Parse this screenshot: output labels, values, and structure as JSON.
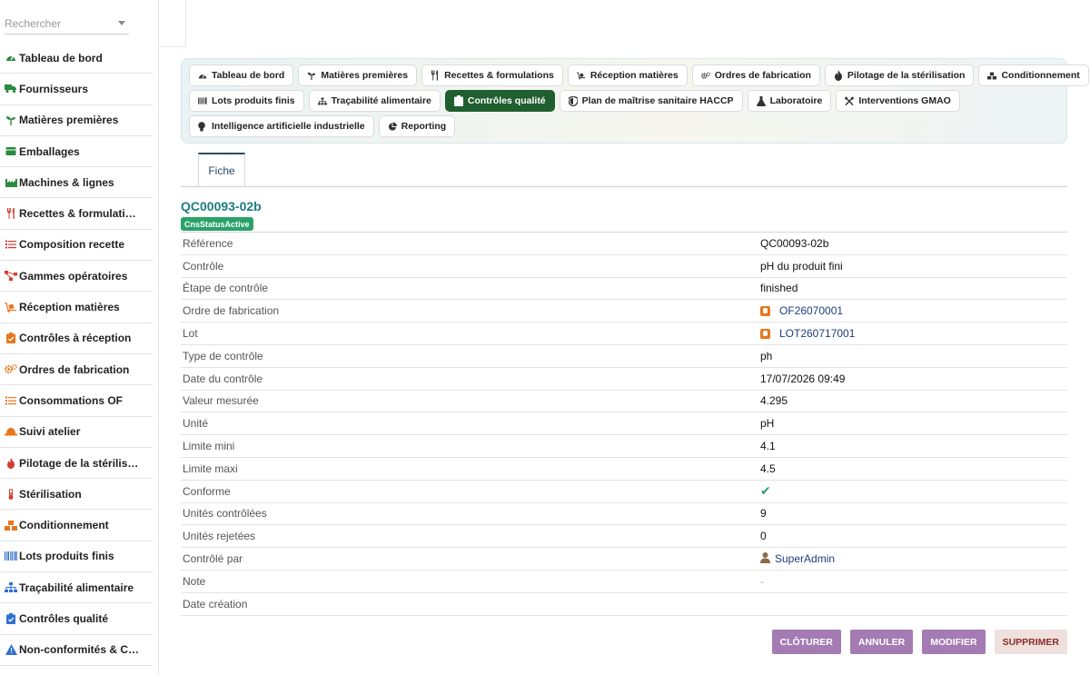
{
  "search": {
    "placeholder": "Rechercher"
  },
  "sidebar": {
    "items": [
      {
        "label": "Tableau de bord",
        "icon": "gauge-icon",
        "color": "#2a8a3e"
      },
      {
        "label": "Fournisseurs",
        "icon": "truck-icon",
        "color": "#2a8a3e"
      },
      {
        "label": "Matières premières",
        "icon": "seedling-icon",
        "color": "#2a8a3e"
      },
      {
        "label": "Emballages",
        "icon": "box-icon",
        "color": "#2a8a3e"
      },
      {
        "label": "Machines & lignes",
        "icon": "industry-icon",
        "color": "#2a8a3e"
      },
      {
        "label": "Recettes & formulati…",
        "icon": "utensils-icon",
        "color": "#d23c2f"
      },
      {
        "label": "Composition recette",
        "icon": "list-icon",
        "color": "#d23c2f"
      },
      {
        "label": "Gammes opératoires",
        "icon": "flow-icon",
        "color": "#d23c2f"
      },
      {
        "label": "Réception matières",
        "icon": "dolly-icon",
        "color": "#e8761d"
      },
      {
        "label": "Contrôles à réception",
        "icon": "clipboard-check-icon",
        "color": "#e8761d"
      },
      {
        "label": "Ordres de fabrication",
        "icon": "gears-icon",
        "color": "#e8761d"
      },
      {
        "label": "Consommations OF",
        "icon": "list-icon",
        "color": "#e8761d"
      },
      {
        "label": "Suivi atelier",
        "icon": "hardhat-icon",
        "color": "#e8761d"
      },
      {
        "label": "Pilotage de la stérilis…",
        "icon": "fire-icon",
        "color": "#d23c2f"
      },
      {
        "label": "Stérilisation",
        "icon": "thermometer-icon",
        "color": "#d23c2f"
      },
      {
        "label": "Conditionnement",
        "icon": "boxes-icon",
        "color": "#e8761d"
      },
      {
        "label": "Lots produits finis",
        "icon": "barcode-icon",
        "color": "#2f6fd1"
      },
      {
        "label": "Traçabilité alimentaire",
        "icon": "sitemap-icon",
        "color": "#2f6fd1"
      },
      {
        "label": "Contrôles qualité",
        "icon": "clipboard-check-icon",
        "color": "#2f6fd1"
      },
      {
        "label": "Non-conformités & C…",
        "icon": "warning-icon",
        "color": "#2f6fd1"
      }
    ]
  },
  "tabs": {
    "rows": [
      [
        {
          "label": "Tableau de bord",
          "icon": "gauge-icon"
        },
        {
          "label": "Matières premières",
          "icon": "seedling-icon"
        },
        {
          "label": "Recettes & formulations",
          "icon": "utensils-icon"
        },
        {
          "label": "Réception matières",
          "icon": "dolly-icon"
        },
        {
          "label": "Ordres de fabrication",
          "icon": "gears-icon"
        },
        {
          "label": "Pilotage de la stérilisation",
          "icon": "fire-icon"
        },
        {
          "label": "Conditionnement",
          "icon": "boxes-icon"
        }
      ],
      [
        {
          "label": "Lots produits finis",
          "icon": "barcode-icon"
        },
        {
          "label": "Traçabilité alimentaire",
          "icon": "sitemap-icon"
        },
        {
          "label": "Contrôles qualité",
          "icon": "clipboard-check-icon",
          "active": true
        },
        {
          "label": "Plan de maîtrise sanitaire HACCP",
          "icon": "shield-icon"
        },
        {
          "label": "Laboratoire",
          "icon": "flask-icon"
        },
        {
          "label": "Interventions GMAO",
          "icon": "tools-icon"
        }
      ],
      [
        {
          "label": "Intelligence artificielle industrielle",
          "icon": "lightbulb-icon"
        },
        {
          "label": "Reporting",
          "icon": "chart-pie-icon"
        }
      ]
    ]
  },
  "fiche_tab": "Fiche",
  "record": {
    "title": "QC00093-02b",
    "status": "CnsStatusActive",
    "fields": [
      {
        "label": "Référence",
        "value": "QC00093-02b",
        "kind": "text"
      },
      {
        "label": "Contrôle",
        "value": "pH du produit fini",
        "kind": "text"
      },
      {
        "label": "Étape de contrôle",
        "value": "finished",
        "kind": "text"
      },
      {
        "label": "Ordre de fabrication",
        "value": "OF26070001",
        "kind": "link-of"
      },
      {
        "label": "Lot",
        "value": "LOT260717001",
        "kind": "link-of"
      },
      {
        "label": "Type de contrôle",
        "value": "ph",
        "kind": "text"
      },
      {
        "label": "Date du contrôle",
        "value": "17/07/2026 09:49",
        "kind": "text"
      },
      {
        "label": "Valeur mesurée",
        "value": "4.295",
        "kind": "text"
      },
      {
        "label": "Unité",
        "value": "pH",
        "kind": "text"
      },
      {
        "label": "Limite mini",
        "value": "4.1",
        "kind": "text"
      },
      {
        "label": "Limite maxi",
        "value": "4.5",
        "kind": "text"
      },
      {
        "label": "Conforme",
        "value": "✔",
        "kind": "check"
      },
      {
        "label": "Unités contrôlées",
        "value": "9",
        "kind": "text"
      },
      {
        "label": "Unités rejetées",
        "value": "0",
        "kind": "text"
      },
      {
        "label": "Contrôlé par",
        "value": "SuperAdmin",
        "kind": "user"
      },
      {
        "label": "Note",
        "value": "-",
        "kind": "dim"
      },
      {
        "label": "Date création",
        "value": "",
        "kind": "text"
      }
    ]
  },
  "actions": {
    "close_label": "CLÔTURER",
    "cancel_label": "ANNULER",
    "edit_label": "MODIFIER",
    "delete_label": "SUPPRIMER"
  }
}
